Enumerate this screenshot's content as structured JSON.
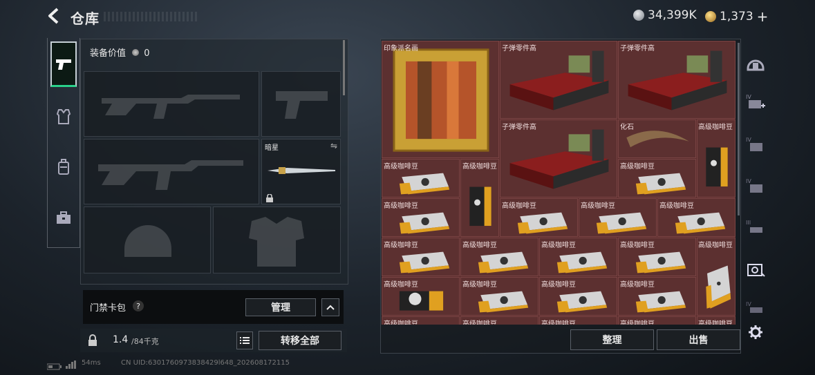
{
  "header": {
    "title": "仓库"
  },
  "currency": {
    "silver": "34,399K",
    "gold": "1,373",
    "gold_plus": "+",
    "silver_color": "#bfc4c9",
    "gold_color": "#d9a64a"
  },
  "tabs": [
    {
      "icon": "pistol-icon",
      "active": true
    },
    {
      "icon": "vest-icon",
      "active": false
    },
    {
      "icon": "backpack-icon",
      "active": false
    },
    {
      "icon": "briefcase-icon",
      "active": false
    }
  ],
  "loadout": {
    "gear_value_label": "装备价值",
    "gear_value": "0",
    "melee_slot_name": "暗星",
    "slots": [
      "primary-weapon-slot",
      "pistol-slot",
      "secondary-weapon-slot",
      "melee-slot",
      "helmet-slot",
      "armor-slot"
    ]
  },
  "card_bag": {
    "label": "门禁卡包",
    "help": "?",
    "manage": "管理"
  },
  "capacity": {
    "current": "1.4",
    "max": "/84千克",
    "transfer_all": "转移全部"
  },
  "grid": {
    "items": [
      {
        "name": "印象派名画",
        "type": "painting"
      },
      {
        "name": "子弹零件高",
        "type": "ammo-parts"
      },
      {
        "name": "子弹零件高",
        "type": "ammo-parts"
      },
      {
        "name": "子弹零件高",
        "type": "ammo-parts"
      },
      {
        "name": "化石",
        "type": "fossil"
      },
      {
        "name": "高级咖啡豆",
        "type": "coffee-bag"
      },
      {
        "name": "高级咖啡豆",
        "type": "coffee-box"
      },
      {
        "name": "高级咖啡豆",
        "type": "coffee-bag"
      },
      {
        "name": "高级咖啡豆",
        "type": "coffee-box"
      },
      {
        "name": "高级咖啡豆",
        "type": "coffee-box"
      },
      {
        "name": "高级咖啡豆",
        "type": "coffee-box"
      },
      {
        "name": "高级咖啡豆",
        "type": "coffee-box"
      },
      {
        "name": "高级咖啡豆",
        "type": "coffee-box"
      },
      {
        "name": "高级咖啡豆",
        "type": "coffee-box"
      },
      {
        "name": "高级咖啡豆",
        "type": "coffee-box"
      },
      {
        "name": "高级咖啡豆",
        "type": "coffee-box"
      },
      {
        "name": "高级咖啡豆",
        "type": "coffee-box"
      },
      {
        "name": "高级咖啡豆",
        "type": "coffee-box"
      },
      {
        "name": "高级咖啡豆",
        "type": "coffee-bag"
      },
      {
        "name": "高级咖啡豆",
        "type": "coffee-box"
      },
      {
        "name": "高级咖啡豆",
        "type": "coffee-box"
      },
      {
        "name": "高级咖啡豆",
        "type": "coffee-box"
      },
      {
        "name": "高级咖啡豆",
        "type": "coffee-box"
      },
      {
        "name": "高级咖啡豆",
        "type": "coffee-box"
      },
      {
        "name": "高级咖啡豆",
        "type": "coffee-box"
      },
      {
        "name": "高级咖啡豆",
        "type": "coffee-box"
      },
      {
        "name": "高级咖啡豆",
        "type": "coffee-box"
      }
    ],
    "sort_label": "整理",
    "sell_label": "出售"
  },
  "side_icons": [
    "helmet-icon",
    "backpack-iv-add-icon",
    "backpack-iv-icon",
    "backpack-iv-icon",
    "backpack-iii-icon",
    "safe-box-icon",
    "backpack-iv-icon",
    "settings-gear-icon"
  ],
  "status": {
    "ping": "54ms",
    "uid": "CN UID:6301760973838429l648_202608172115"
  }
}
